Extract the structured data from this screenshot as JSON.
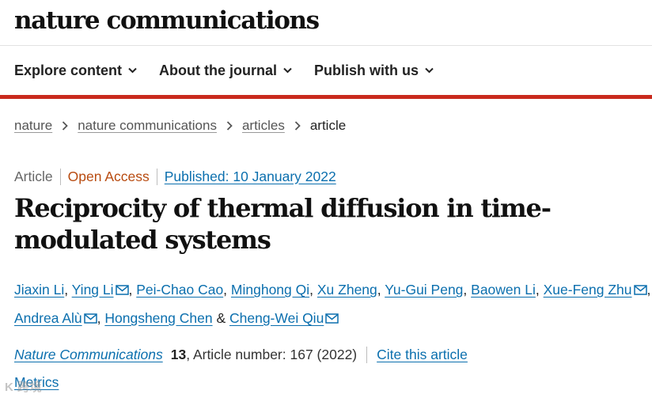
{
  "site": {
    "brand": "nature communications"
  },
  "nav": {
    "items": [
      {
        "label": "Explore content"
      },
      {
        "label": "About the journal"
      },
      {
        "label": "Publish with us"
      }
    ]
  },
  "breadcrumb": {
    "items": [
      {
        "label": "nature"
      },
      {
        "label": "nature communications"
      },
      {
        "label": "articles"
      }
    ],
    "current": "article"
  },
  "article": {
    "type": "Article",
    "access": "Open Access",
    "published": "Published: 10 January 2022",
    "title": "Reciprocity of thermal diffusion in time-modulated systems",
    "authors": [
      {
        "name": "Jiaxin Li"
      },
      {
        "name": "Ying Li"
      },
      {
        "name": "Pei-Chao Cao"
      },
      {
        "name": "Minghong Qi"
      },
      {
        "name": "Xu Zheng"
      },
      {
        "name": "Yu-Gui Peng"
      },
      {
        "name": "Baowen Li"
      },
      {
        "name": "Xue-Feng Zhu"
      },
      {
        "name": "Andrea Alù"
      },
      {
        "name": "Hongsheng Chen"
      },
      {
        "name": "Cheng-Wei Qiu"
      }
    ],
    "author_separator": ", ",
    "author_last_separator": " & ",
    "journal": "Nature Communications",
    "volume": "13",
    "article_number": ", Article number: 167 (2022)",
    "cite_label": "Cite this article",
    "metrics_label": "Metrics"
  },
  "watermark": "K 跨境"
}
